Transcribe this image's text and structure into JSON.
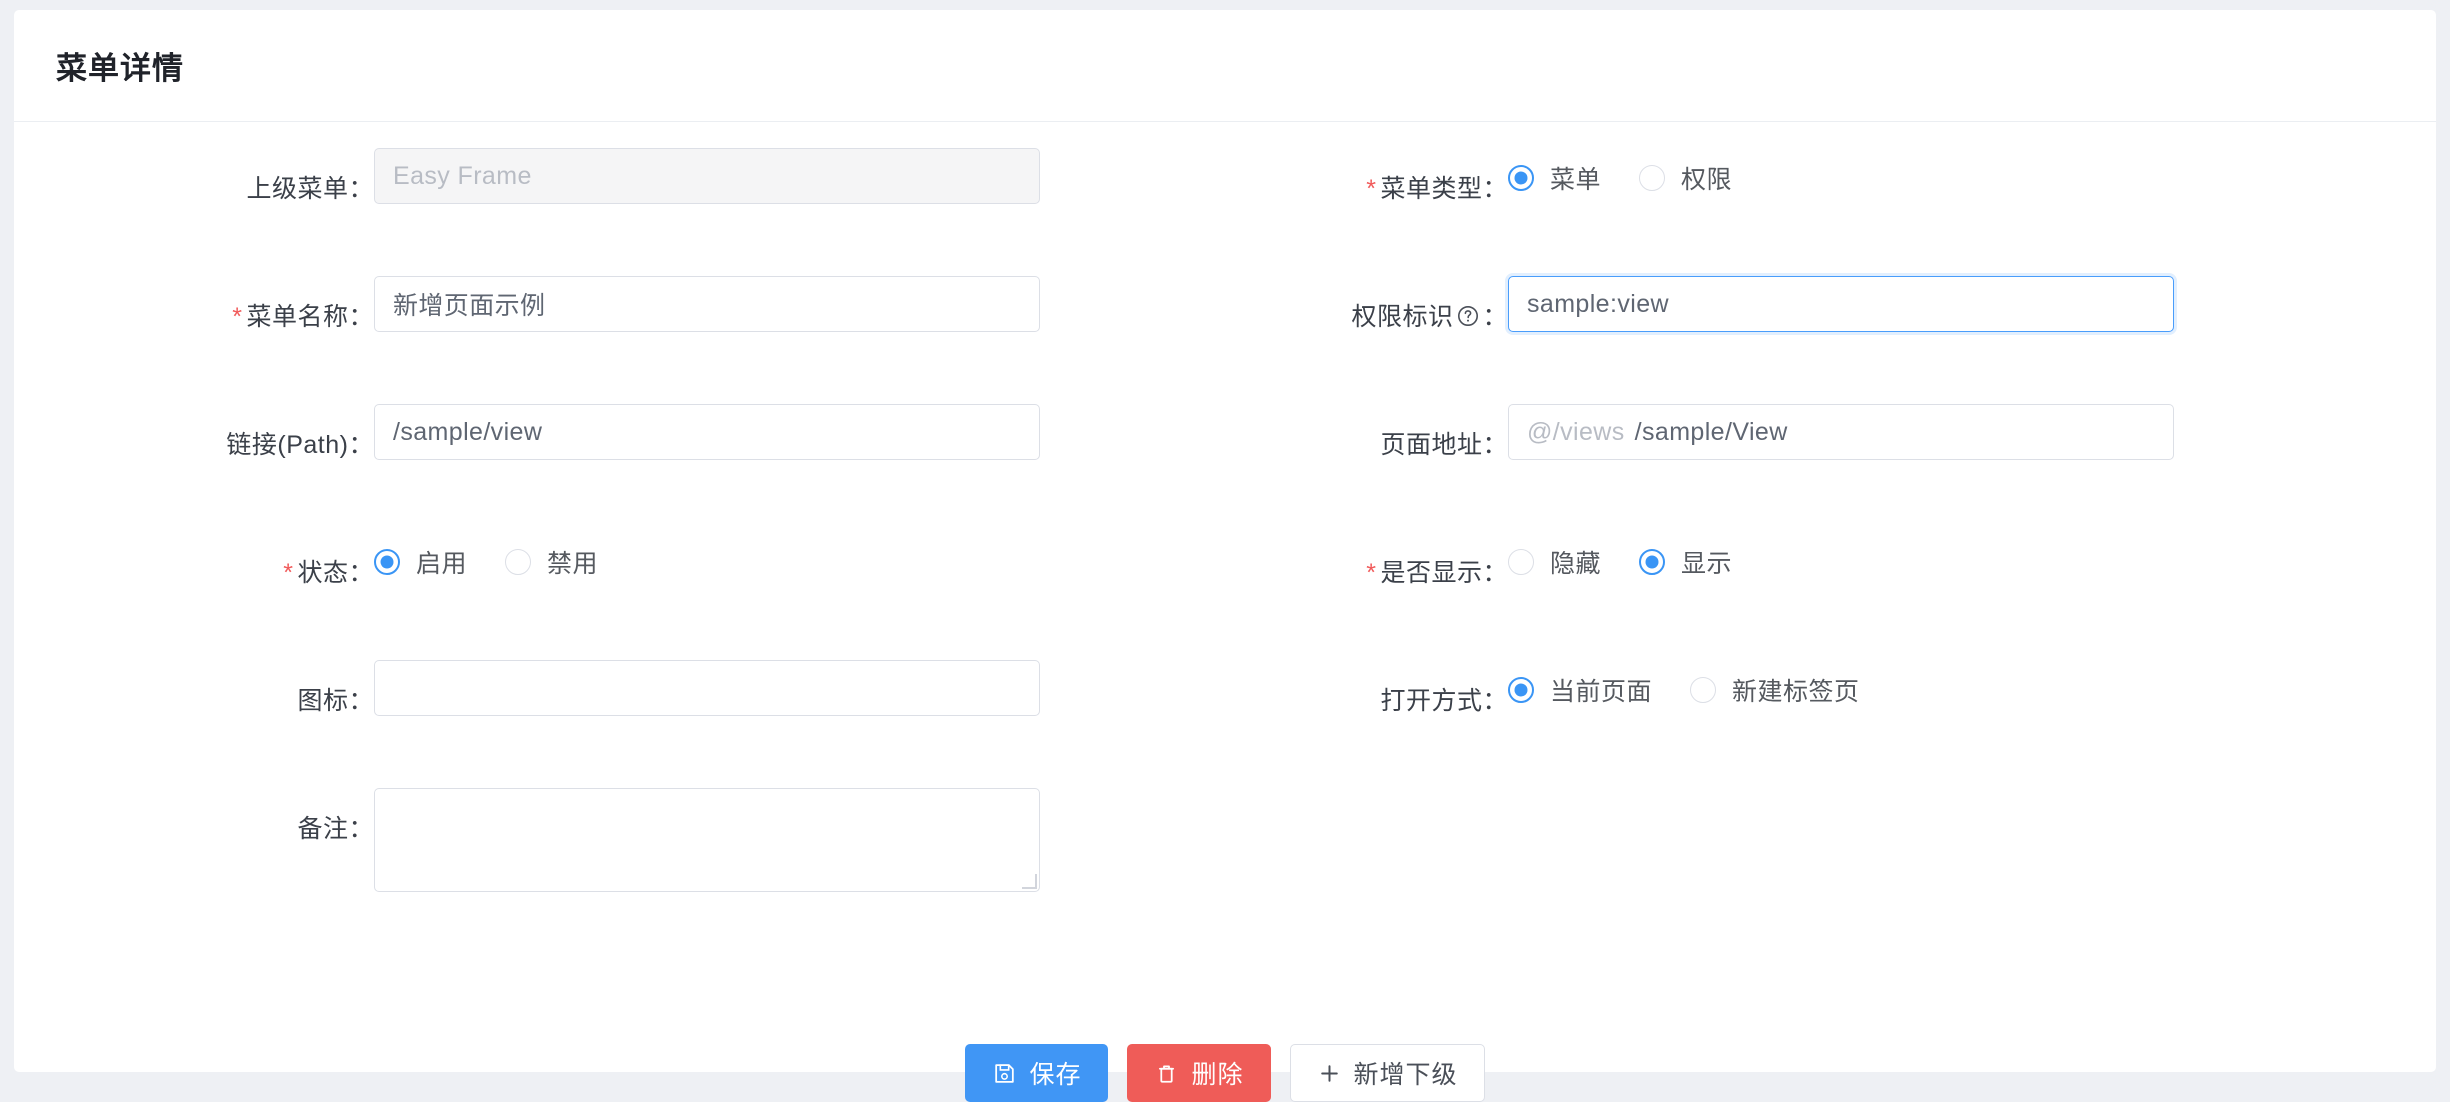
{
  "header": {
    "title": "菜单详情"
  },
  "colors": {
    "primary": "#4096f5",
    "danger": "#ef5c58",
    "required_star": "#f15b5b",
    "radio_active": "#3a95f5",
    "focus_border": "#4a9dfb",
    "page_background": "#eef0f4",
    "card_background": "#ffffff"
  },
  "form": {
    "left": {
      "parent_menu": {
        "label": "上级菜单：",
        "value": "Easy Frame",
        "required": false,
        "disabled": true
      },
      "menu_name": {
        "label": "菜单名称：",
        "value": "新增页面示例",
        "required": true,
        "star": "*"
      },
      "path": {
        "label": "链接(Path)：",
        "value": "/sample/view",
        "required": false
      },
      "status": {
        "label": "状态：",
        "required": true,
        "star": "*",
        "options": [
          {
            "label": "启用",
            "selected": true
          },
          {
            "label": "禁用",
            "selected": false
          }
        ]
      },
      "icon": {
        "label": "图标：",
        "value": "",
        "required": false
      },
      "remark": {
        "label": "备注：",
        "value": "",
        "required": false
      }
    },
    "right": {
      "menu_type": {
        "label": "菜单类型：",
        "required": true,
        "star": "*",
        "options": [
          {
            "label": "菜单",
            "selected": true
          },
          {
            "label": "权限",
            "selected": false
          }
        ]
      },
      "permission_key": {
        "label": "权限标识",
        "label_suffix": "：",
        "help_icon": "question-circle-icon",
        "value": "sample:view",
        "required": false,
        "focused": true
      },
      "page_address": {
        "label": "页面地址：",
        "prefix": "@/views",
        "value": "/sample/View",
        "required": false
      },
      "visible": {
        "label": "是否显示：",
        "required": true,
        "star": "*",
        "options": [
          {
            "label": "隐藏",
            "selected": false
          },
          {
            "label": "显示",
            "selected": true
          }
        ]
      },
      "open_mode": {
        "label": "打开方式：",
        "required": false,
        "options": [
          {
            "label": "当前页面",
            "selected": true
          },
          {
            "label": "新建标签页",
            "selected": false
          }
        ]
      }
    }
  },
  "buttons": [
    {
      "label": "保存",
      "icon": "save-icon",
      "variant": "primary"
    },
    {
      "label": "删除",
      "icon": "trash-icon",
      "variant": "danger"
    },
    {
      "label": "新增下级",
      "icon": "plus-icon",
      "variant": "plain"
    }
  ]
}
